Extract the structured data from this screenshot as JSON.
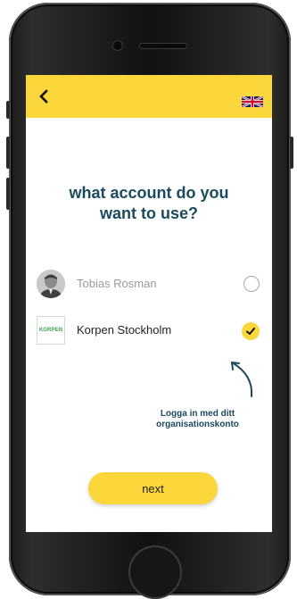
{
  "header": {
    "back_icon": "chevron-left-icon",
    "language_icon": "uk-flag-icon"
  },
  "main": {
    "title_line1": "what account do you",
    "title_line2": "want to use?"
  },
  "accounts": [
    {
      "name": "Tobias Rosman",
      "selected": false,
      "avatar": "person-photo"
    },
    {
      "name": "Korpen Stockholm",
      "selected": true,
      "logo_text": "KORPEN"
    }
  ],
  "hint": {
    "line1": "Logga in med ditt",
    "line2": "organisationskonto"
  },
  "footer": {
    "next_label": "next"
  },
  "colors": {
    "accent": "#fcd73b",
    "heading": "#1b4a5e",
    "logo_green": "#3aa64b"
  }
}
